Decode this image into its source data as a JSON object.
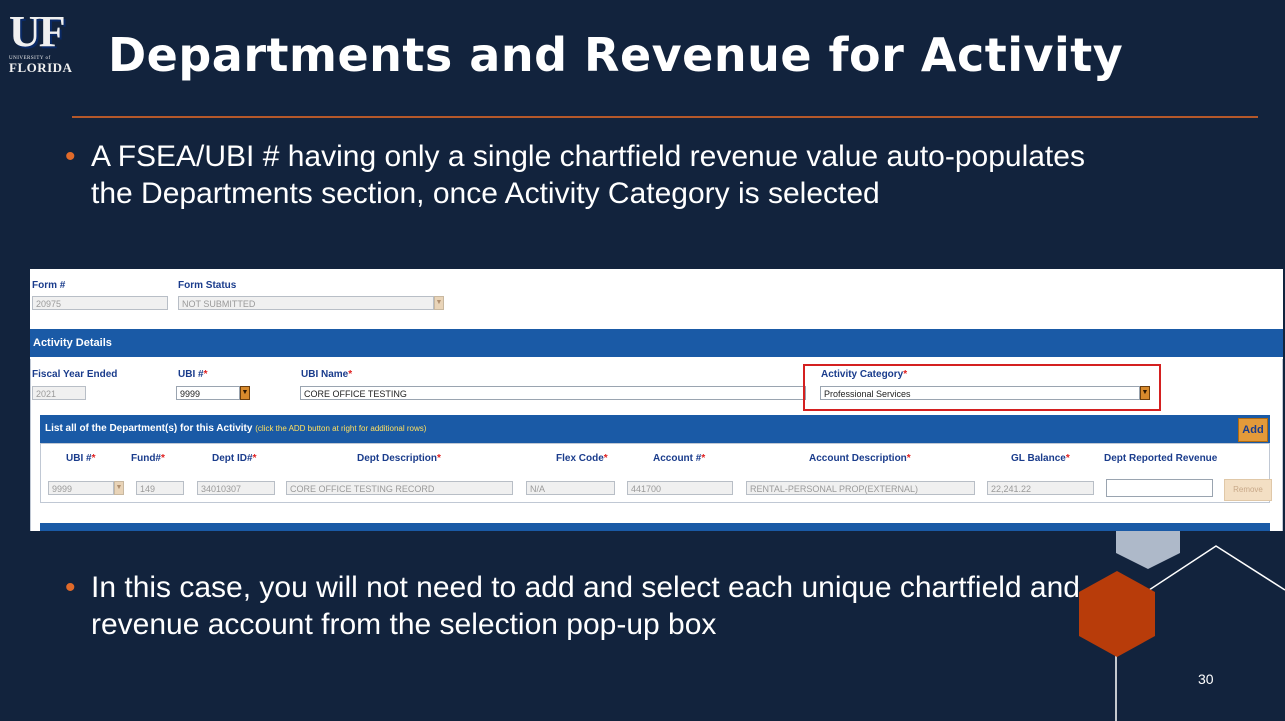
{
  "logo": {
    "mark": "UF",
    "sub": "UNIVERSITY of",
    "name": "FLORIDA"
  },
  "slide": {
    "title": "Departments and Revenue for Activity",
    "bullet1": "A FSEA/UBI # having only a single chartfield revenue value auto-populates the Departments section, once Activity Category is selected",
    "bullet2": "In this case, you will not need to add and select each unique chartfield and revenue account from the selection pop-up box",
    "page_number": "30"
  },
  "form": {
    "form_no_label": "Form #",
    "form_no_value": "20975",
    "status_label": "Form Status",
    "status_value": "NOT SUBMITTED"
  },
  "activity": {
    "section_title": "Activity Details",
    "fy_label": "Fiscal Year Ended",
    "fy_value": "2021",
    "ubi_label": "UBI #",
    "ubi_value": "9999",
    "ubi_name_label": "UBI Name",
    "ubi_name_value": "CORE OFFICE TESTING",
    "category_label": "Activity Category",
    "category_value": "Professional Services",
    "required_mark": "*"
  },
  "departments": {
    "title": "List all of the Department(s) for this Activity",
    "hint": "(click the ADD button at right for additional rows)",
    "add_label": "Add",
    "remove_label": "Remove",
    "columns": [
      "UBI #",
      "Fund#",
      "Dept ID#",
      "Dept Description",
      "Flex Code",
      "Account #",
      "Account Description",
      "GL Balance",
      "Dept Reported Revenue"
    ],
    "row": {
      "ubi": "9999",
      "fund": "149",
      "dept_id": "34010307",
      "dept_desc": "CORE OFFICE TESTING RECORD",
      "flex": "N/A",
      "account": "441700",
      "account_desc": "RENTAL-PERSONAL PROP(EXTERNAL)",
      "gl_balance": "22,241.22",
      "reported_revenue": ""
    }
  },
  "colors": {
    "background": "#12233d",
    "accent": "#b5582a",
    "header_blue": "#1a5aa6",
    "highlight": "#d42020",
    "hexagon": "#b83c0a"
  }
}
